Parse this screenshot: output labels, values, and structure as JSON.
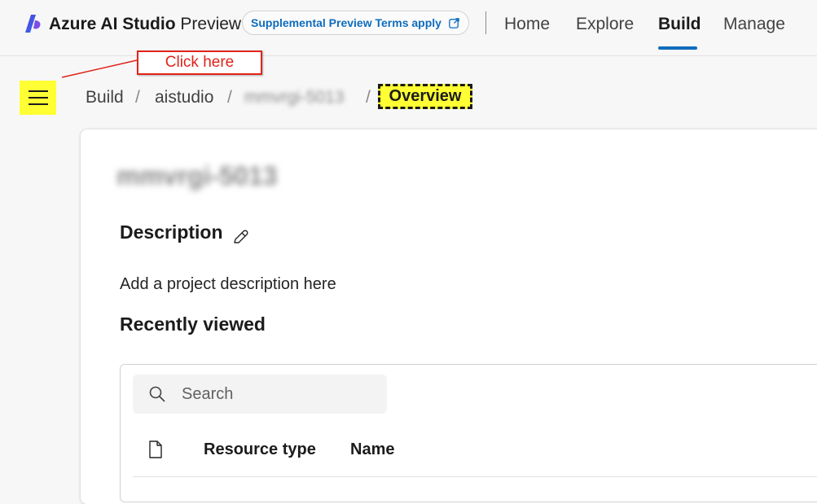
{
  "app": {
    "brand_main": "Azure AI Studio",
    "brand_sub": "Preview",
    "terms_label": "Supplemental Preview Terms apply",
    "terms_icon": "external-link-icon"
  },
  "nav": {
    "items": [
      {
        "label": "Home",
        "active": false
      },
      {
        "label": "Explore",
        "active": false
      },
      {
        "label": "Build",
        "active": true
      },
      {
        "label": "Manage",
        "active": false
      }
    ],
    "accent_color": "#0f6cbd"
  },
  "annotation": {
    "callout_text": "Click here",
    "callout_color": "#e0231b",
    "highlight_color": "#ffff33"
  },
  "sidebar": {
    "toggle_icon": "hamburger-menu-icon"
  },
  "breadcrumb": {
    "items": [
      "Build",
      "aistudio",
      "mmvrgi-5013"
    ],
    "separator": "/",
    "current": "Overview"
  },
  "project": {
    "name": "mmvrgi-5013",
    "description_heading": "Description",
    "description_placeholder": "Add a project description here",
    "edit_icon": "pencil-icon"
  },
  "recently_viewed": {
    "heading": "Recently viewed",
    "search_placeholder": "Search",
    "columns": {
      "icon": "document-icon",
      "resource_type": "Resource type",
      "name": "Name"
    }
  }
}
